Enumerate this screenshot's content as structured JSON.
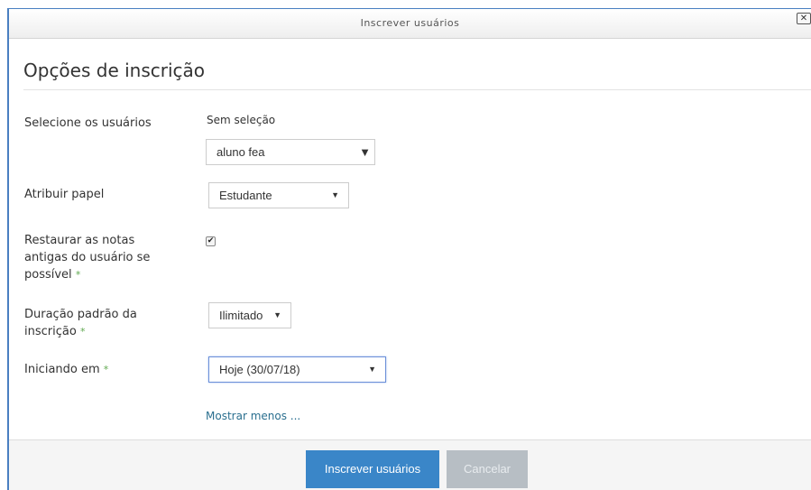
{
  "dialog": {
    "title": "Inscrever usuários",
    "close_glyph": "✕"
  },
  "section": {
    "title": "Opções de inscrição"
  },
  "fields": {
    "users": {
      "label": "Selecione os usuários",
      "selection_status": "Sem seleção",
      "search_value": "aluno fea"
    },
    "role": {
      "label": "Atribuir papel",
      "value": "Estudante"
    },
    "recover_grades": {
      "label": "Restaurar as notas antigas do usuário se possível",
      "checked": true
    },
    "duration": {
      "label": "Duração padrão da inscrição",
      "value": "Ilimitado"
    },
    "start": {
      "label": "Iniciando em",
      "value": "Hoje (30/07/18)"
    },
    "required_marker": "*"
  },
  "show_less_link": "Mostrar menos ...",
  "footer": {
    "submit_label": "Inscrever usuários",
    "cancel_label": "Cancelar"
  },
  "colors": {
    "accent": "#3a86c8",
    "required": "#5fa84f",
    "link": "#2a6f8f"
  }
}
